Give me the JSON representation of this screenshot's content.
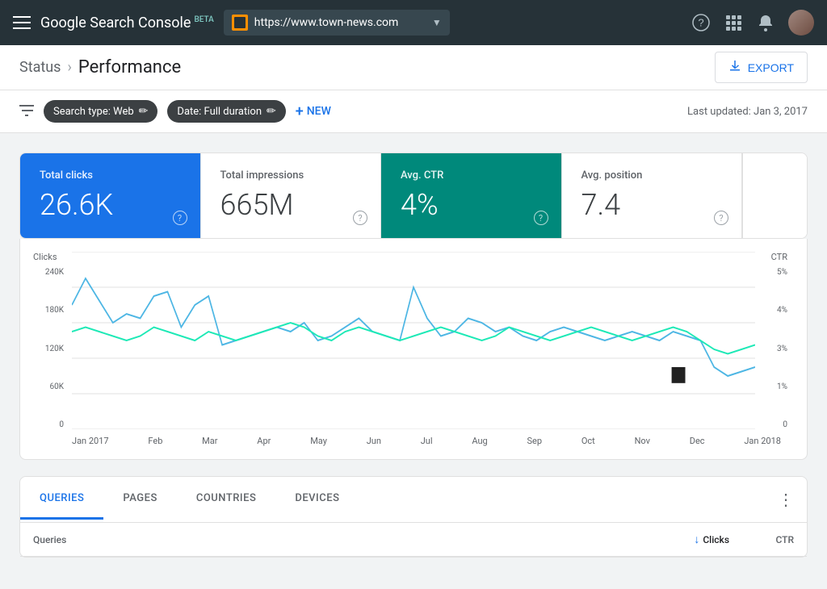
{
  "topNav": {
    "hamburger_label": "Menu",
    "logo": "Google Search Console",
    "logo_beta": "BETA",
    "url": "https://www.town-news.com",
    "help_icon": "?",
    "apps_icon": "⠿",
    "notifications_icon": "🔔"
  },
  "breadcrumb": {
    "status_label": "Status",
    "separator": "›",
    "current_label": "Performance",
    "export_label": "EXPORT"
  },
  "filterBar": {
    "search_type_label": "Search type: Web",
    "date_label": "Date: Full duration",
    "new_label": "NEW",
    "last_updated": "Last updated: Jan 3, 2017"
  },
  "metrics": [
    {
      "id": "total-clicks",
      "label": "Total clicks",
      "value": "26.6K",
      "active": "blue"
    },
    {
      "id": "total-impressions",
      "label": "Total impressions",
      "value": "665M",
      "active": "none"
    },
    {
      "id": "avg-ctr",
      "label": "Avg. CTR",
      "value": "4%",
      "active": "teal"
    },
    {
      "id": "avg-position",
      "label": "Avg. position",
      "value": "7.4",
      "active": "none"
    }
  ],
  "chart": {
    "y_left_label": "Clicks",
    "y_right_label": "CTR",
    "y_left_values": [
      "240K",
      "180K",
      "120K",
      "60K",
      "0"
    ],
    "y_right_values": [
      "5%",
      "4%",
      "3%",
      "1%",
      "0"
    ],
    "x_labels": [
      "Jan 2017",
      "Feb",
      "Mar",
      "Apr",
      "May",
      "Jun",
      "Jul",
      "Aug",
      "Sep",
      "Oct",
      "Nov",
      "Dec",
      "Jan 2018"
    ]
  },
  "tabs": {
    "items": [
      {
        "id": "queries",
        "label": "QUERIES",
        "active": true
      },
      {
        "id": "pages",
        "label": "PAGES",
        "active": false
      },
      {
        "id": "countries",
        "label": "COUNTRIES",
        "active": false
      },
      {
        "id": "devices",
        "label": "DEVICES",
        "active": false
      }
    ],
    "more_icon": "⋮"
  },
  "tableHeader": {
    "col1": "Queries",
    "col2": "Clicks",
    "col3": "CTR",
    "sort_arrow": "↓"
  },
  "colors": {
    "blue_line": "#4db6e4",
    "teal_line": "#1de9b6",
    "grid": "#e0e0e0"
  }
}
